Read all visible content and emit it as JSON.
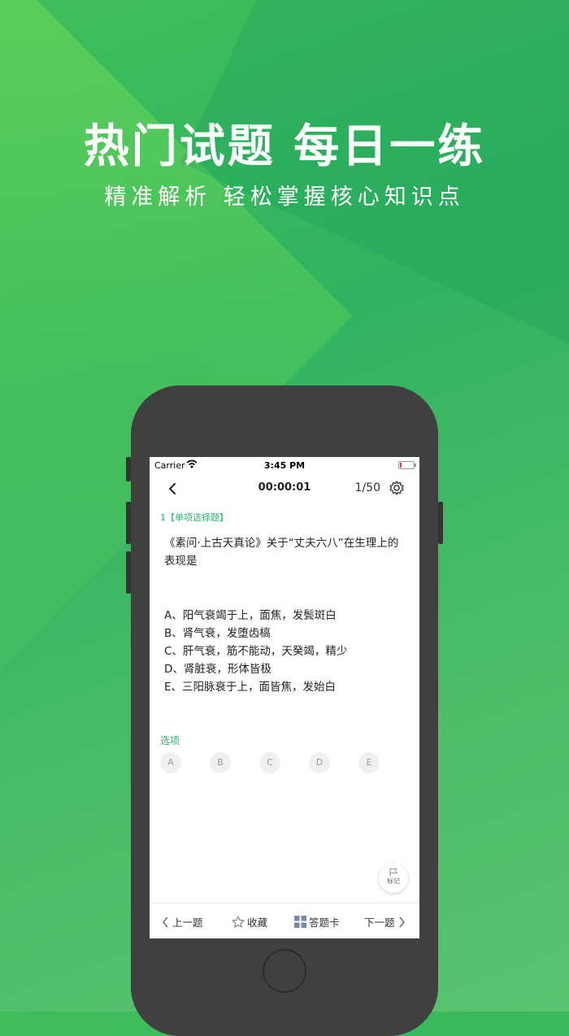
{
  "promo": {
    "headline": "热门试题 每日一练",
    "subline": "精准解析 轻松掌握核心知识点"
  },
  "status_bar": {
    "carrier": "Carrier",
    "time": "3:45 PM"
  },
  "nav": {
    "timer": "00:00:01",
    "progress": "1/50"
  },
  "question": {
    "type_label": "1【单项选择题】",
    "text": "《素问·上古天真论》关于“丈夫六八”在生理上的表现是",
    "options": [
      "A、阳气衰竭于上，面焦，发鬓斑白",
      "B、肾气衰，发堕齿槁",
      "C、肝气衰，筋不能动，天癸竭，精少",
      "D、肾脏衰，形体皆极",
      "E、三阳脉衰于上，面皆焦，发始白"
    ]
  },
  "answer_section": {
    "label": "选项",
    "choices": [
      "A",
      "B",
      "C",
      "D",
      "E"
    ]
  },
  "mark_button": {
    "label": "标记"
  },
  "bottom_bar": {
    "prev": "上一题",
    "favorite": "收藏",
    "answer_card": "答题卡",
    "next": "下一题"
  },
  "icons": [
    "back-icon",
    "gear-icon",
    "wifi-icon",
    "battery-icon",
    "flag-icon",
    "chevron-left-icon",
    "star-icon",
    "grid-icon",
    "chevron-right-icon"
  ],
  "colors": {
    "accent": "#2db36b",
    "background_green": "#3cb85e"
  }
}
